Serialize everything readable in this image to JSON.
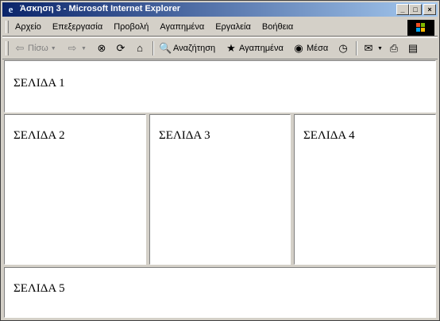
{
  "window": {
    "title": "Άσκηση 3 - Microsoft Internet Explorer",
    "controls": {
      "minimize": "_",
      "maximize": "□",
      "close": "×"
    }
  },
  "menubar": {
    "items": [
      "Αρχείο",
      "Επεξεργασία",
      "Προβολή",
      "Αγαπημένα",
      "Εργαλεία",
      "Βοήθεια"
    ]
  },
  "toolbar": {
    "back_label": "Πίσω",
    "search_label": "Αναζήτηση",
    "favorites_label": "Αγαπημένα",
    "media_label": "Μέσα",
    "icons": {
      "back": "back-arrow-icon",
      "forward": "forward-arrow-icon",
      "stop": "stop-icon",
      "refresh": "refresh-icon",
      "home": "home-icon",
      "search": "search-icon",
      "favorites": "favorites-icon",
      "media": "media-icon",
      "history": "history-icon",
      "mail": "mail-icon",
      "print": "print-icon",
      "edit": "edit-icon"
    }
  },
  "frames": {
    "page1": "ΣΕΛΙΔΑ 1",
    "page2": "ΣΕΛΙΔΑ 2",
    "page3": "ΣΕΛΙΔΑ 3",
    "page4": "ΣΕΛΙΔΑ 4",
    "page5": "ΣΕΛΙΔΑ 5"
  },
  "colors": {
    "titlebar_start": "#0a246a",
    "titlebar_end": "#a6caf0",
    "chrome": "#d4d0c8",
    "frame_bg": "#ffffff"
  }
}
